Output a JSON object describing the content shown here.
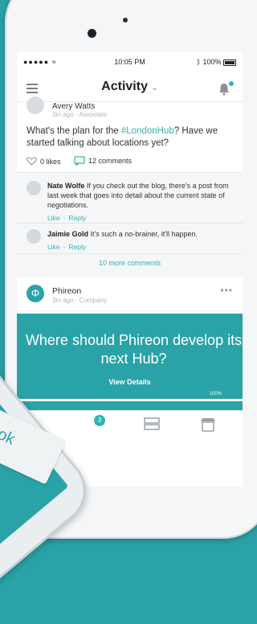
{
  "colors": {
    "accent": "#2fb5b4",
    "brand_teal": "#2aa3a8"
  },
  "status_bar": {
    "carrier": "●●●●● ",
    "time": "10:05 PM",
    "battery": "100%"
  },
  "header": {
    "title": "Activity"
  },
  "post": {
    "author": "Avery Watts",
    "meta": "3m ago · Associate",
    "text_before": "What's the plan for the ",
    "hashtag": "#LondonHub",
    "text_after": "? Have we started talking about locations yet?",
    "likes": "0 likes",
    "comments": "12 comments"
  },
  "comments": [
    {
      "name": "Nate Wolfe",
      "text": "If you check out the blog, there's a post from last week that goes into detail about the current state of negotiations.",
      "like": "Like",
      "reply": "Reply"
    },
    {
      "name": "Jaimie Gold",
      "text": "It's such a no-brainer, it'll happen.",
      "like": "Like",
      "reply": "Reply"
    }
  ],
  "more_comments": "10 more comments",
  "company_post": {
    "name": "Phireon",
    "meta": "3m ago · Company",
    "more": "•••",
    "promo_title": "Where should Phireon develop its next Hub?",
    "cta": "View Details",
    "progress_label": "100%",
    "progress": 1.0
  },
  "tabbar": {
    "badge": "3"
  },
  "foreground": {
    "button_text": "ok"
  }
}
